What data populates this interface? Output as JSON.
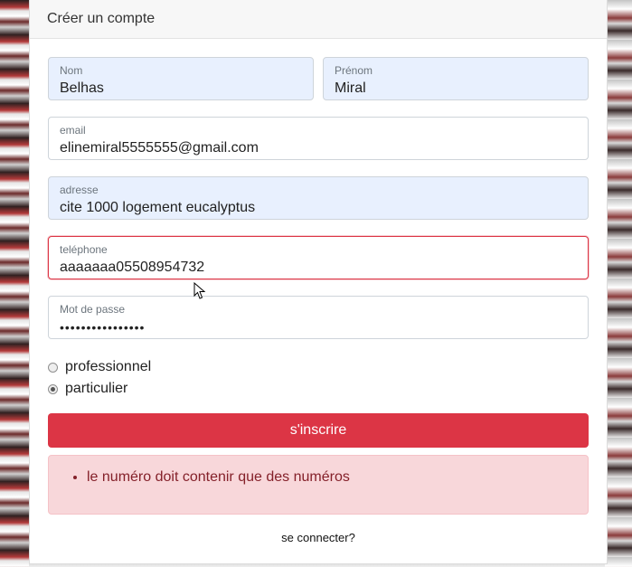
{
  "header": {
    "title": "Créer un compte"
  },
  "form": {
    "nom": {
      "label": "Nom",
      "value": "Belhas"
    },
    "prenom": {
      "label": "Prénom",
      "value": "Miral"
    },
    "email": {
      "label": "email",
      "value": "elinemiral5555555@gmail.com"
    },
    "adresse": {
      "label": "adresse",
      "value": "cite 1000 logement eucalyptus"
    },
    "telephone": {
      "label": "teléphone",
      "value": "aaaaaaa05508954732"
    },
    "password": {
      "label": "Mot de passe",
      "value": "••••••••••••••••"
    },
    "account_type": {
      "options": [
        {
          "label": "professionnel",
          "selected": false
        },
        {
          "label": "particulier",
          "selected": true
        }
      ]
    },
    "submit_label": "s'inscrire",
    "errors": [
      "le numéro doit contenir que des numéros"
    ],
    "login_link": "se connecter?"
  },
  "colors": {
    "danger": "#dc3545",
    "autofill": "#e8f0fe",
    "alert_bg": "#f8d7da"
  }
}
